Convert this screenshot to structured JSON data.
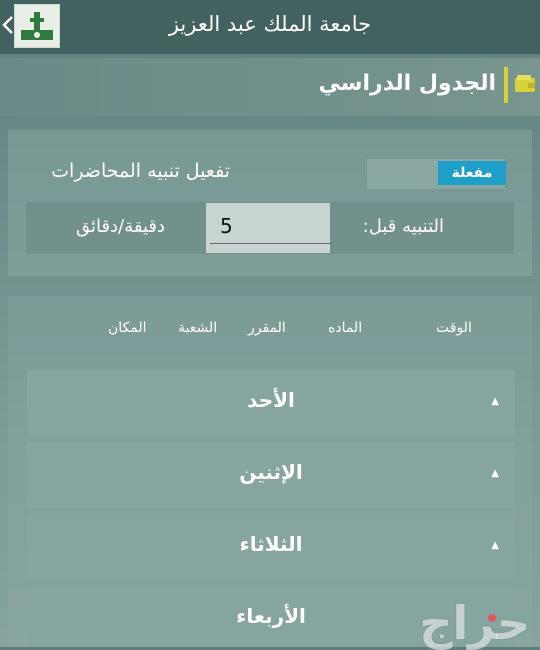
{
  "header": {
    "title": "جامعة الملك عبد العزيز"
  },
  "section": {
    "title": "الجدول الدراسي"
  },
  "alerts": {
    "label": "تفعيل تنبيه المحاضرات",
    "toggle_state": "مفعلة",
    "before_label": "التنبيه قبل:",
    "minutes_value": "5",
    "minutes_unit": "دقيقة/دقائق"
  },
  "schedule": {
    "columns": [
      "الوقت",
      "الماده",
      "المقرر",
      "الشعبة",
      "المكان"
    ],
    "days": [
      "الأحد",
      "الإثنين",
      "الثلاثاء",
      "الأربعاء"
    ]
  },
  "watermark": "حراج",
  "colors": {
    "topbar": "#41625f",
    "accent_toggle": "#1e9fc9",
    "head_bar": "#d8d23a",
    "watermark_dot": "#e4565a"
  }
}
